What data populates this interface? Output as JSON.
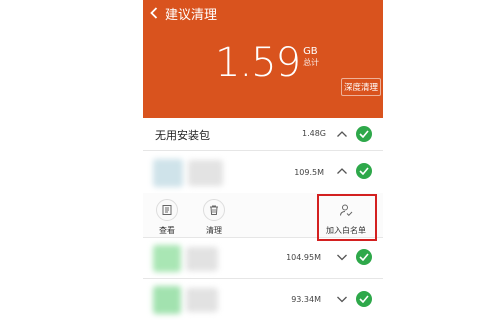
{
  "header": {
    "title": "建议清理",
    "total_value": "1.59",
    "total_unit": "GB",
    "total_caption": "总计",
    "deep_clean_label": "深度清理",
    "bg_color": "#d9531e"
  },
  "section": {
    "title": "无用安装包",
    "size": "1.48G"
  },
  "items": [
    {
      "size": "109.5M",
      "expanded": true
    },
    {
      "size": "104.95M",
      "expanded": false
    },
    {
      "size": "93.34M",
      "expanded": false
    }
  ],
  "actions": {
    "view_label": "查看",
    "clean_label": "清理",
    "whitelist_label": "加入白名单"
  },
  "icons": {
    "back": "chevron-left-icon",
    "view": "document-icon",
    "clean": "trash-icon",
    "whitelist": "person-check-icon",
    "checkmark": "check-icon"
  },
  "colors": {
    "accent": "#d9531e",
    "check": "#2ea84a",
    "highlight": "#d32020"
  }
}
